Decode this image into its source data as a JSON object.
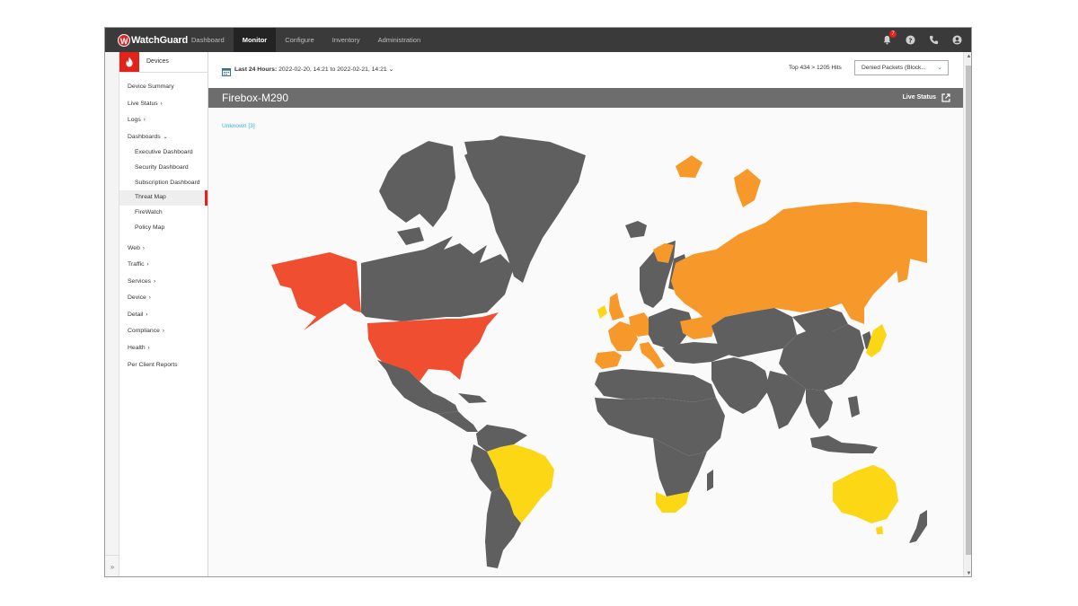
{
  "app": {
    "logo_text": "WatchGuard"
  },
  "nav": {
    "items": [
      {
        "label": "Dashboard",
        "active": false
      },
      {
        "label": "Monitor",
        "active": true
      },
      {
        "label": "Configure",
        "active": false
      },
      {
        "label": "Inventory",
        "active": false
      },
      {
        "label": "Administration",
        "active": false
      }
    ]
  },
  "topbar": {
    "notification_count": "7"
  },
  "sidebar": {
    "devices_label": "Devices",
    "items": [
      {
        "label": "Device Summary",
        "chev": ""
      },
      {
        "label": "Live Status",
        "chev": "›"
      },
      {
        "label": "Logs",
        "chev": "›"
      },
      {
        "label": "Dashboards",
        "chev": "⌄"
      },
      {
        "label": "Executive Dashboard",
        "sub": true
      },
      {
        "label": "Security Dashboard",
        "sub": true
      },
      {
        "label": "Subscription Dashboard",
        "sub": true
      },
      {
        "label": "Threat Map",
        "sub": true,
        "active": true
      },
      {
        "label": "FireWatch",
        "sub": true
      },
      {
        "label": "Policy Map",
        "sub": true
      },
      {
        "label": "Web",
        "chev": "›"
      },
      {
        "label": "Traffic",
        "chev": "›"
      },
      {
        "label": "Services",
        "chev": "›"
      },
      {
        "label": "Device",
        "chev": "›"
      },
      {
        "label": "Detail",
        "chev": "›"
      },
      {
        "label": "Compliance",
        "chev": "›"
      },
      {
        "label": "Health",
        "chev": "›"
      },
      {
        "label": "Per Client Reports",
        "chev": ""
      }
    ],
    "collapse_label": "»"
  },
  "filter": {
    "range_label": "Last 24 Hours:",
    "range_value": "2022-02-20, 14:21 to 2022-02-21, 14:21",
    "top_hits": "Top 434 > 1205 Hits",
    "report_select": "Denied Packets (Block..."
  },
  "device": {
    "title": "Firebox-M290",
    "live_status_label": "Live Status"
  },
  "map": {
    "unknown_label": "Unknown [3]",
    "colors": {
      "land": "#5f5f5f",
      "high": "#f04e31",
      "medium": "#f7992a",
      "low": "#fcd716",
      "background": "#fafafa"
    },
    "high_countries": [
      "United States",
      "Alaska (US)"
    ],
    "medium_countries": [
      "Russia",
      "Spain",
      "France",
      "United Kingdom",
      "Germany",
      "Netherlands",
      "Italy",
      "Ukraine",
      "Sweden",
      "Norway",
      "Svalbard"
    ],
    "low_countries": [
      "Brazil",
      "Australia",
      "South Africa",
      "Japan",
      "Ireland"
    ]
  }
}
